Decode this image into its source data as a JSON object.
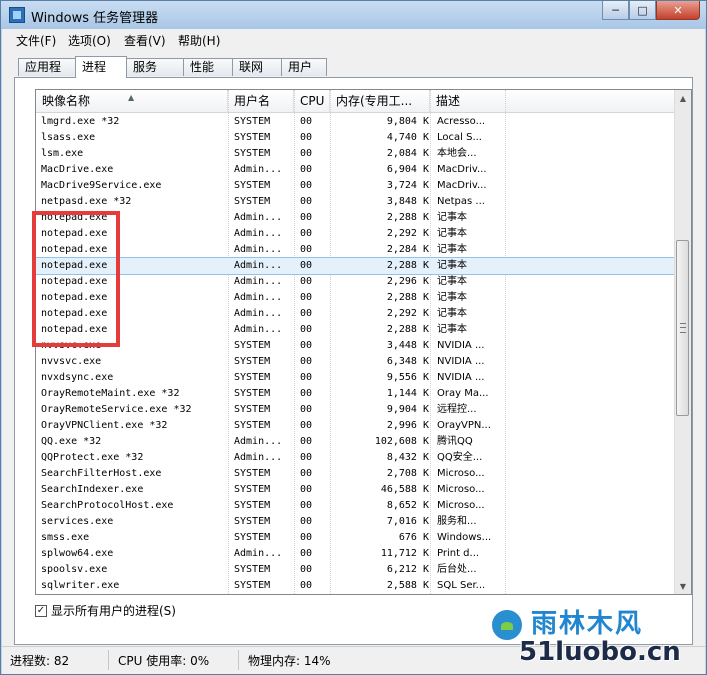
{
  "window": {
    "title": "Windows 任务管理器",
    "minimize": "─",
    "maximize": "□",
    "close": "✕"
  },
  "menu": [
    "文件(F)",
    "选项(O)",
    "查看(V)",
    "帮助(H)"
  ],
  "tabs": [
    "应用程序",
    "进程",
    "服务",
    "性能",
    "联网",
    "用户"
  ],
  "active_tab": "进程",
  "columns": [
    "映像名称",
    "用户名",
    "CPU",
    "内存(专用工...",
    "描述"
  ],
  "rows": [
    [
      "lmgrd.exe *32",
      "SYSTEM",
      "00",
      "9,804 K",
      "Acresso..."
    ],
    [
      "lsass.exe",
      "SYSTEM",
      "00",
      "4,740 K",
      "Local S..."
    ],
    [
      "lsm.exe",
      "SYSTEM",
      "00",
      "2,084 K",
      "本地会..."
    ],
    [
      "MacDrive.exe",
      "Admin...",
      "00",
      "6,904 K",
      "MacDriv..."
    ],
    [
      "MacDrive9Service.exe",
      "SYSTEM",
      "00",
      "3,724 K",
      "MacDriv..."
    ],
    [
      "netpasd.exe *32",
      "SYSTEM",
      "00",
      "3,848 K",
      "Netpas ..."
    ],
    [
      "notepad.exe",
      "Admin...",
      "00",
      "2,288 K",
      "记事本"
    ],
    [
      "notepad.exe",
      "Admin...",
      "00",
      "2,292 K",
      "记事本"
    ],
    [
      "notepad.exe",
      "Admin...",
      "00",
      "2,284 K",
      "记事本"
    ],
    [
      "notepad.exe",
      "Admin...",
      "00",
      "2,288 K",
      "记事本"
    ],
    [
      "notepad.exe",
      "Admin...",
      "00",
      "2,296 K",
      "记事本"
    ],
    [
      "notepad.exe",
      "Admin...",
      "00",
      "2,288 K",
      "记事本"
    ],
    [
      "notepad.exe",
      "Admin...",
      "00",
      "2,292 K",
      "记事本"
    ],
    [
      "notepad.exe",
      "Admin...",
      "00",
      "2,288 K",
      "记事本"
    ],
    [
      "nvvsvc.exe",
      "SYSTEM",
      "00",
      "3,448 K",
      "NVIDIA ..."
    ],
    [
      "nvvsvc.exe",
      "SYSTEM",
      "00",
      "6,348 K",
      "NVIDIA ..."
    ],
    [
      "nvxdsync.exe",
      "SYSTEM",
      "00",
      "9,556 K",
      "NVIDIA ..."
    ],
    [
      "OrayRemoteMaint.exe *32",
      "SYSTEM",
      "00",
      "1,144 K",
      "Oray Ma..."
    ],
    [
      "OrayRemoteService.exe *32",
      "SYSTEM",
      "00",
      "9,904 K",
      "远程控..."
    ],
    [
      "OrayVPNClient.exe *32",
      "SYSTEM",
      "00",
      "2,996 K",
      "OrayVPN..."
    ],
    [
      "QQ.exe *32",
      "Admin...",
      "00",
      "102,608 K",
      "腾讯QQ"
    ],
    [
      "QQProtect.exe *32",
      "Admin...",
      "00",
      "8,432 K",
      "QQ安全..."
    ],
    [
      "SearchFilterHost.exe",
      "SYSTEM",
      "00",
      "2,708 K",
      "Microso..."
    ],
    [
      "SearchIndexer.exe",
      "SYSTEM",
      "00",
      "46,588 K",
      "Microso..."
    ],
    [
      "SearchProtocolHost.exe",
      "SYSTEM",
      "00",
      "8,652 K",
      "Microso..."
    ],
    [
      "services.exe",
      "SYSTEM",
      "00",
      "7,016 K",
      "服务和..."
    ],
    [
      "smss.exe",
      "SYSTEM",
      "00",
      "676 K",
      "Windows..."
    ],
    [
      "splwow64.exe",
      "Admin...",
      "00",
      "11,712 K",
      "Print d..."
    ],
    [
      "spoolsv.exe",
      "SYSTEM",
      "00",
      "6,212 K",
      "后台处..."
    ],
    [
      "sqlwriter.exe",
      "SYSTEM",
      "00",
      "2,588 K",
      "SQL Ser..."
    ]
  ],
  "selected_row": 9,
  "show_all_users": {
    "label": "显示所有用户的进程(S)",
    "checked": "✓"
  },
  "status": {
    "processes": "进程数: 82",
    "cpu": "CPU 使用率: 0%",
    "memory": "物理内存: 14%"
  },
  "watermark": {
    "cn": "雨林木风",
    "en": "51luobo.cn"
  },
  "colors": {
    "highlight_box": "#e43b3b",
    "selection": "#e4f1fb"
  }
}
